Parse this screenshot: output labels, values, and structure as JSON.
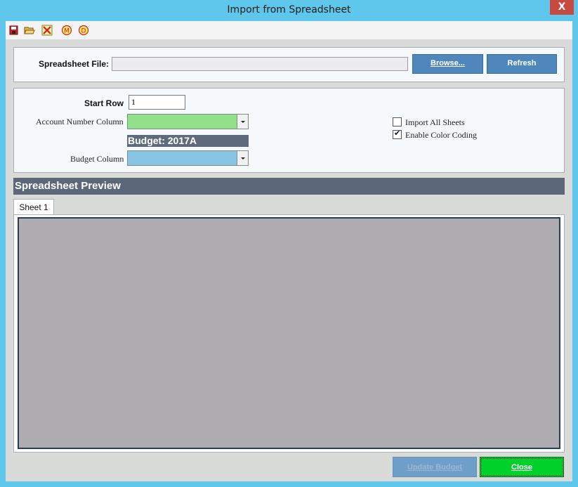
{
  "window": {
    "title": "Import from Spreadsheet",
    "close_glyph": "X"
  },
  "toolbar": {
    "icons": [
      "save-icon",
      "open-folder-icon",
      "delete-icon",
      "m-circle-icon",
      "d-circle-icon"
    ],
    "m_letter": "M",
    "d_letter": "D"
  },
  "file_panel": {
    "label": "Spreadsheet File:",
    "path_value": "",
    "browse_label": "Browse...",
    "refresh_label": "Refresh"
  },
  "options_panel": {
    "start_row_label": "Start Row",
    "start_row_value": "1",
    "account_column_label": "Account Number Column",
    "account_column_value": "",
    "account_column_color": "#93e08a",
    "budget_banner": "Budget: 2017A",
    "budget_column_label": "Budget Column",
    "budget_column_value": "",
    "budget_column_color": "#87c4e3",
    "import_all_sheets_label": "Import All Sheets",
    "import_all_sheets_checked": false,
    "enable_color_coding_label": "Enable Color Coding",
    "enable_color_coding_checked": true,
    "check_glyph": "✔"
  },
  "preview": {
    "header": "Spreadsheet Preview",
    "tabs": [
      {
        "label": "Sheet 1",
        "active": true
      }
    ]
  },
  "footer": {
    "update_budget_label": "Update Budget",
    "update_budget_enabled": false,
    "close_label": "Close"
  },
  "colors": {
    "title_bar": "#5fc7ec",
    "accent_button": "#4f87bd",
    "close_button": "#00d12a",
    "header_bar": "#5c6879"
  }
}
